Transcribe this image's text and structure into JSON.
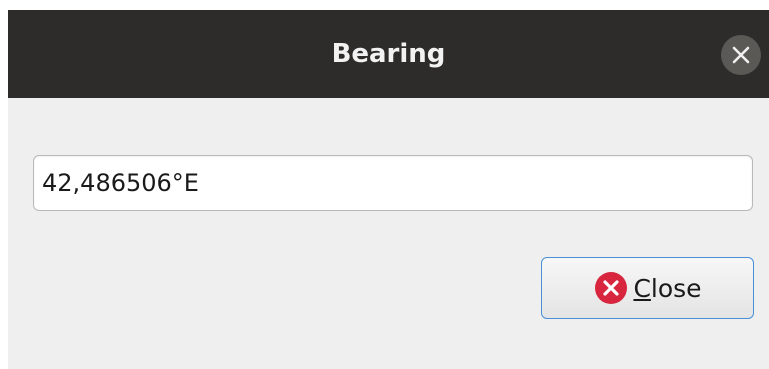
{
  "window": {
    "title": "Bearing",
    "close_icon": "close-icon"
  },
  "bearing_field": {
    "value": "42,486506°E"
  },
  "close_button": {
    "icon": "error-circle-icon",
    "mnemonic": "C",
    "label_rest": "lose",
    "icon_color": "#d7263d"
  },
  "colors": {
    "titlebar": "#2e2c2a",
    "dialog_background": "#efefef",
    "focus_border": "#4a8fd8"
  }
}
